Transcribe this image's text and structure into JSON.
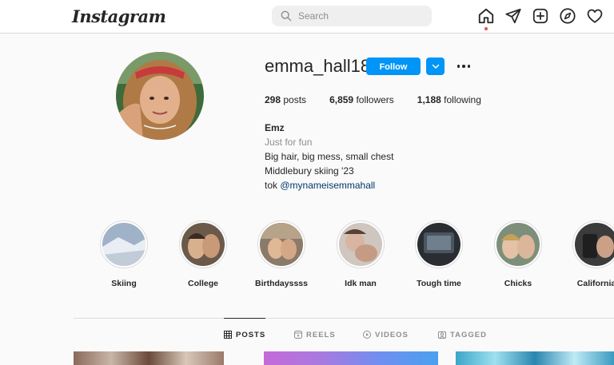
{
  "header": {
    "logo_text": "Instagram",
    "search_placeholder": "Search",
    "nav_icons": [
      "home-icon",
      "direct-message-icon",
      "new-post-icon",
      "explore-icon",
      "activity-heart-icon"
    ],
    "notification_color": "#ed4956"
  },
  "profile": {
    "username": "emma_hall18",
    "follow_label": "Follow",
    "accent": "#0095f6",
    "stats": {
      "posts_count": "298",
      "posts_label": "posts",
      "followers_count": "6,859",
      "followers_label": "followers",
      "following_count": "1,188",
      "following_label": "following"
    },
    "bio": {
      "name": "Emz",
      "category": "Just for fun",
      "line1": "Big hair, big mess, small chest",
      "line2": "Middlebury skiing '23",
      "line3_prefix": "tok ",
      "line3_handle": "@mynameisemmahall"
    }
  },
  "highlights": [
    {
      "label": "Skiing"
    },
    {
      "label": "College"
    },
    {
      "label": "Birthdayssss"
    },
    {
      "label": "Idk man"
    },
    {
      "label": "Tough time"
    },
    {
      "label": "Chicks"
    },
    {
      "label": "California"
    }
  ],
  "tabs": [
    {
      "label": "POSTS",
      "icon": "grid-icon",
      "active": true
    },
    {
      "label": "REELS",
      "icon": "reels-icon",
      "active": false
    },
    {
      "label": "VIDEOS",
      "icon": "video-play-icon",
      "active": false
    },
    {
      "label": "TAGGED",
      "icon": "tagged-icon",
      "active": false
    }
  ]
}
